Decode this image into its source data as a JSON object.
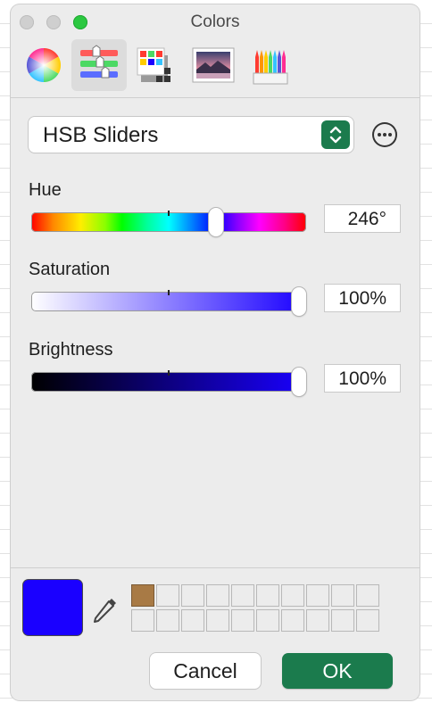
{
  "window": {
    "title": "Colors"
  },
  "toolbar": {
    "tabs": [
      {
        "icon": "color-wheel-icon",
        "active": false
      },
      {
        "icon": "color-sliders-icon",
        "active": true
      },
      {
        "icon": "color-palettes-icon",
        "active": false
      },
      {
        "icon": "image-palettes-icon",
        "active": false
      },
      {
        "icon": "pencils-icon",
        "active": false
      }
    ]
  },
  "mode": {
    "selected": "HSB Sliders"
  },
  "sliders": [
    {
      "label": "Hue",
      "value": "246°",
      "fraction": 0.68
    },
    {
      "label": "Saturation",
      "value": "100%",
      "fraction": 1.0
    },
    {
      "label": "Brightness",
      "value": "100%",
      "fraction": 1.0
    }
  ],
  "current_color": "#1a00ff",
  "swatch_colors": [
    "#a87a45"
  ],
  "buttons": {
    "cancel": "Cancel",
    "ok": "OK"
  },
  "colors": {
    "accent": "#1b7b4d"
  }
}
